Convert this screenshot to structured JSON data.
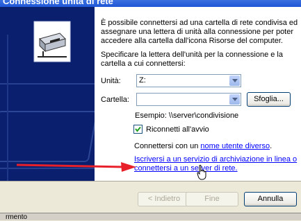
{
  "window": {
    "title": "Connessione unità di rete"
  },
  "intro": {
    "line1": "È possibile connettersi ad una cartella di rete condivisa ed",
    "line2": "assegnare una lettera di unità alla connessione per poter",
    "line3": "accedere alla cartella dall'icona Risorse del computer."
  },
  "instruction": {
    "line1": "Specificare la lettera dell'unità per la connessione e la",
    "line2": "cartella a cui connettersi:"
  },
  "drive": {
    "label": "Unità:",
    "value": "Z:"
  },
  "folder": {
    "label": "Cartella:",
    "value": "",
    "browse_label": "Sfoglia..."
  },
  "example": "Esempio: \\\\server\\condivisione",
  "reconnect": {
    "label": "Riconnetti all'avvio",
    "checked": true
  },
  "connect_other": {
    "prefix": "Connettersi con un ",
    "link": "nome utente diverso",
    "suffix": "."
  },
  "signup": {
    "line1": "Iscriversi a un servizio di archiviazione in linea o",
    "line2": "connettersi a un server di rete."
  },
  "buttons": {
    "back": "< Indietro",
    "finish": "Fine",
    "cancel": "Annulla"
  },
  "behind_window": {
    "text": "rmento"
  },
  "colors": {
    "sidebar": "#0A1F6E",
    "link": "#0000FF",
    "arrow": "#E8202A"
  }
}
